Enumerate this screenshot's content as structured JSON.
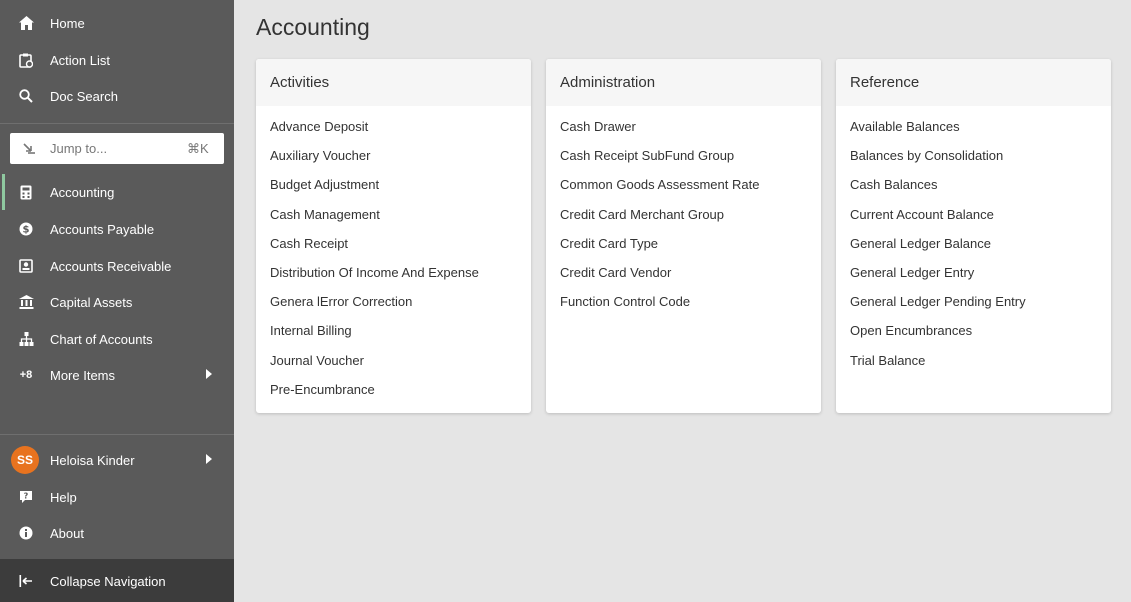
{
  "sidebar": {
    "top_items": [
      {
        "label": "Home",
        "icon": "home-icon"
      },
      {
        "label": "Action List",
        "icon": "clipboard-icon"
      },
      {
        "label": "Doc Search",
        "icon": "search-icon"
      }
    ],
    "jump": {
      "placeholder": "Jump to...",
      "shortcut": "⌘K"
    },
    "modules": [
      {
        "label": "Accounting",
        "icon": "calculator-icon",
        "active": true
      },
      {
        "label": "Accounts Payable",
        "icon": "money-circle-icon"
      },
      {
        "label": "Accounts Receivable",
        "icon": "receipt-icon"
      },
      {
        "label": "Capital Assets",
        "icon": "bank-icon"
      },
      {
        "label": "Chart of Accounts",
        "icon": "org-chart-icon"
      },
      {
        "label": "More Items",
        "badge": "+8"
      }
    ],
    "user": {
      "initials": "SS",
      "name": "Heloisa Kinder"
    },
    "help_label": "Help",
    "about_label": "About",
    "collapse_label": "Collapse Navigation"
  },
  "main": {
    "title": "Accounting",
    "cards": [
      {
        "title": "Activities",
        "links": [
          "Advance Deposit",
          "Auxiliary Voucher",
          "Budget Adjustment",
          "Cash Management",
          "Cash Receipt",
          "Distribution Of Income And Expense",
          "Genera lError Correction",
          "Internal Billing",
          "Journal Voucher",
          "Pre-Encumbrance"
        ]
      },
      {
        "title": "Administration",
        "links": [
          "Cash Drawer",
          "Cash Receipt SubFund Group",
          "Common Goods Assessment Rate",
          "Credit Card Merchant Group",
          "Credit Card Type",
          "Credit Card Vendor",
          "Function Control Code"
        ]
      },
      {
        "title": "Reference",
        "links": [
          "Available Balances",
          "Balances by Consolidation",
          "Cash Balances",
          "Current Account Balance",
          "General Ledger Balance",
          "General Ledger Entry",
          "General Ledger Pending Entry",
          "Open Encumbrances",
          "Trial Balance"
        ]
      }
    ]
  },
  "colors": {
    "sidebar_bg": "#5a5a5a",
    "sidebar_footer_bg": "#3c3c3c",
    "active_accent": "#8fc9a0",
    "avatar_bg": "#e8731f",
    "page_bg": "#e5e5e5"
  }
}
